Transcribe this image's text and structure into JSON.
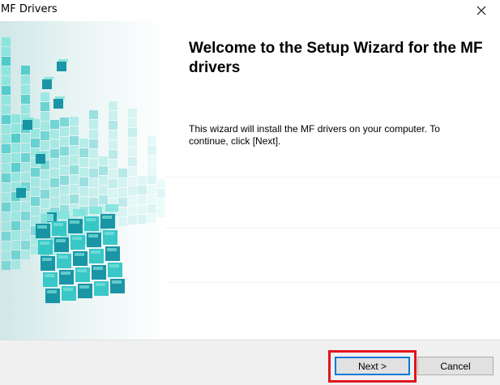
{
  "window": {
    "title": "MF Drivers"
  },
  "titlebar": {
    "close_icon": "close-icon"
  },
  "graphic": {
    "icon": "cube-blocks-graphic",
    "colors": {
      "light": "#7fe3dc",
      "mid": "#2fc4c4",
      "dark": "#0f8fa0",
      "deep": "#0b5f73"
    }
  },
  "content": {
    "heading": "Welcome to the Setup Wizard for the MF drivers",
    "body": "This wizard will install the MF drivers on your computer. To continue, click [Next]."
  },
  "buttons": {
    "next_label": "Next >",
    "cancel_label": "Cancel"
  },
  "colors": {
    "highlight": "#e0141e",
    "default_button_border": "#0078d7"
  }
}
